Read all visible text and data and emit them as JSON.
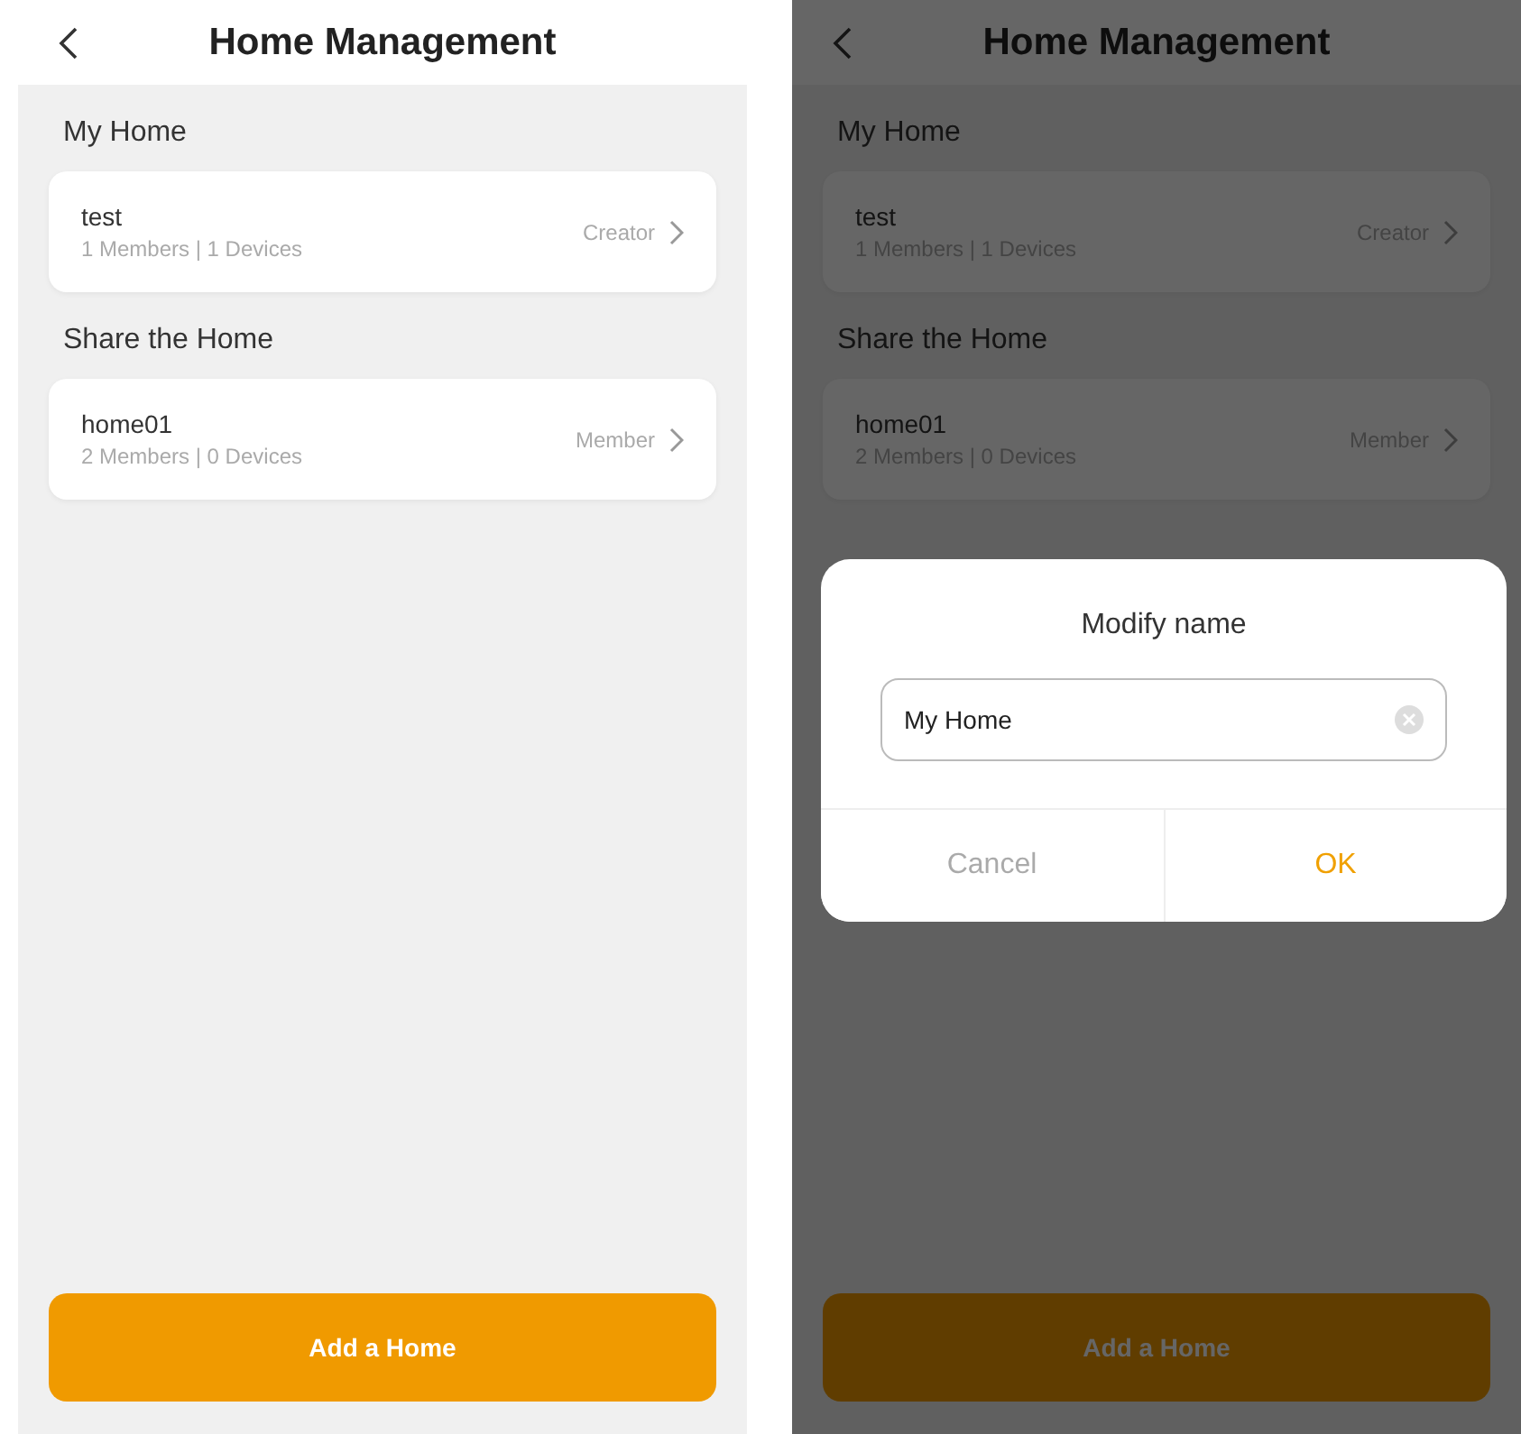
{
  "screens": [
    {
      "title": "Home Management",
      "sections": [
        {
          "heading": "My Home",
          "homes": [
            {
              "name": "test",
              "stats": "1 Members | 1 Devices",
              "role": "Creator"
            }
          ]
        },
        {
          "heading": "Share the Home",
          "homes": [
            {
              "name": "home01",
              "stats": "2 Members | 0 Devices",
              "role": "Member"
            }
          ]
        }
      ],
      "add_button": "Add a Home"
    },
    {
      "title": "Home Management",
      "sections": [
        {
          "heading": "My Home",
          "homes": [
            {
              "name": "test",
              "stats": "1 Members | 1 Devices",
              "role": "Creator"
            }
          ]
        },
        {
          "heading": "Share the Home",
          "homes": [
            {
              "name": "home01",
              "stats": "2 Members | 0 Devices",
              "role": "Member"
            }
          ]
        }
      ],
      "add_button": "Add a Home",
      "dialog": {
        "title": "Modify name",
        "value": "My Home",
        "buttons": [
          {
            "label": "Cancel",
            "kind": "secondary"
          },
          {
            "label": "OK",
            "kind": "primary"
          }
        ]
      }
    }
  ]
}
